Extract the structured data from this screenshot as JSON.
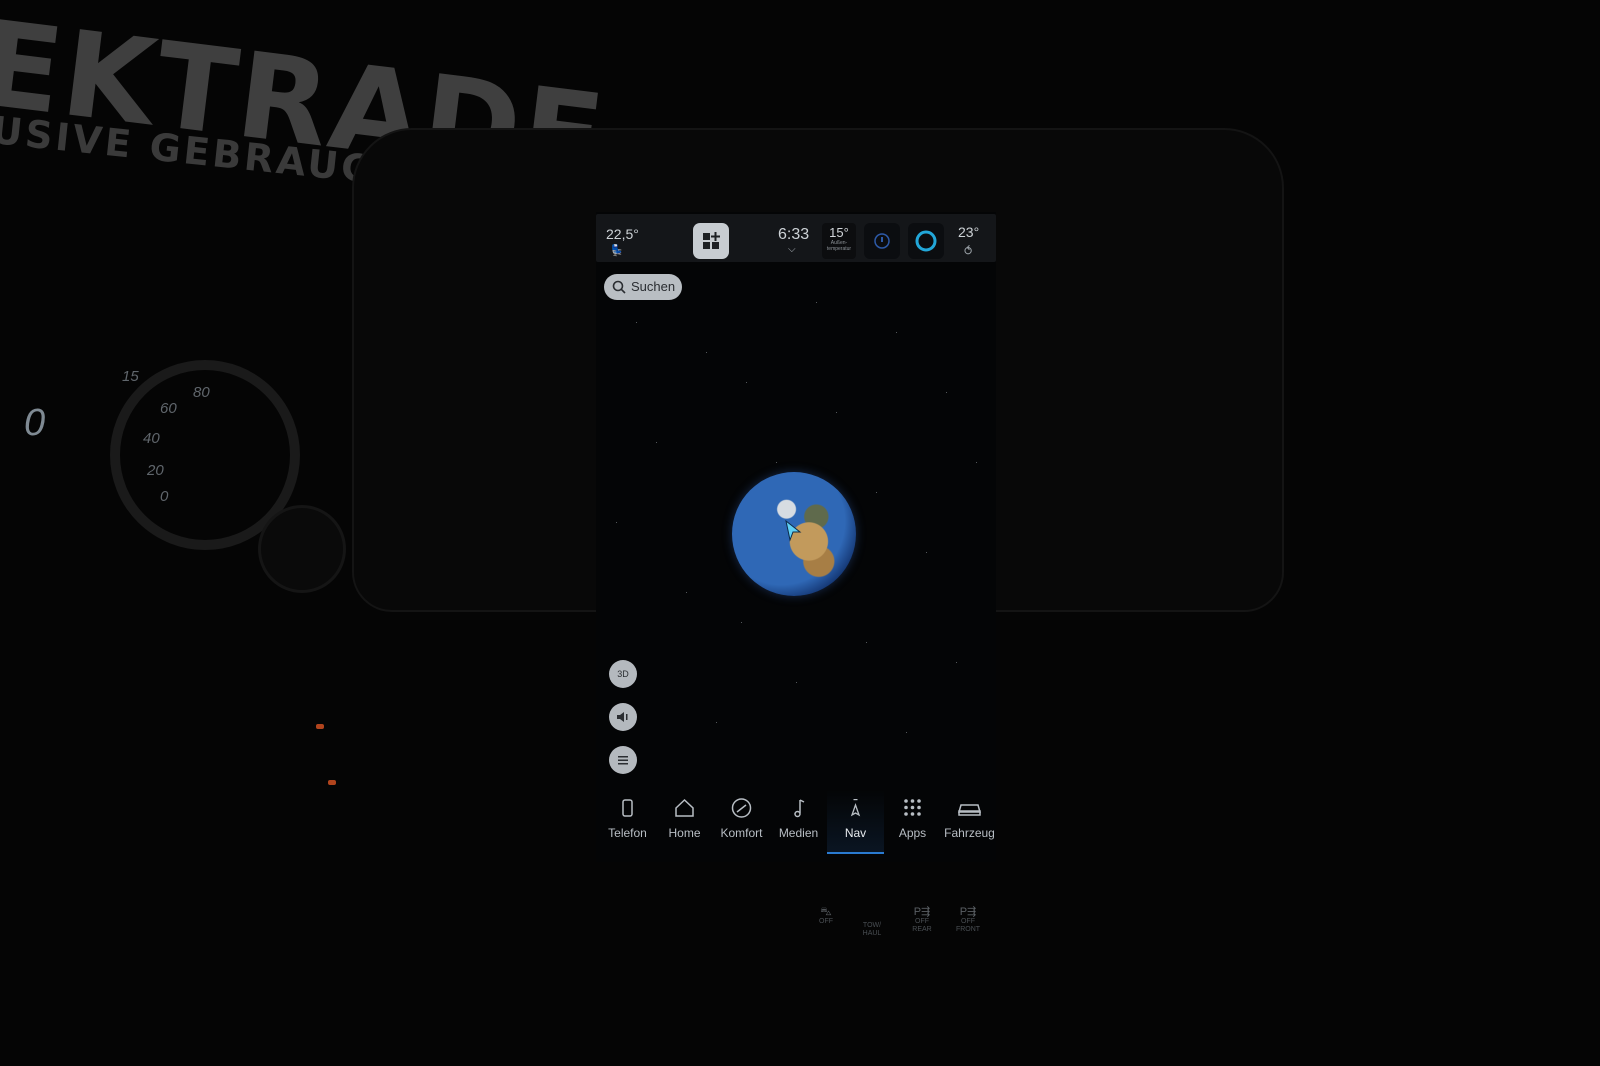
{
  "background": {
    "sign_main": "EKTRADE",
    "sign_sub": "USIVE GEBRAUCHTWAG",
    "cluster_speed": "0",
    "gauge_numbers": [
      "15",
      "80",
      "60",
      "40",
      "20",
      "0"
    ]
  },
  "status_bar": {
    "driver_temp": "22,5°",
    "clock": "6:33",
    "outside_temp": "15°",
    "outside_temp_label": "Außen-temperatur",
    "passenger_temp": "23°"
  },
  "search": {
    "label": "Suchen"
  },
  "map_controls": {
    "view_mode": "3D"
  },
  "nav": {
    "items": [
      {
        "label": "Telefon",
        "icon": "phone-icon"
      },
      {
        "label": "Home",
        "icon": "home-icon"
      },
      {
        "label": "Komfort",
        "icon": "comfort-icon"
      },
      {
        "label": "Medien",
        "icon": "music-note-icon"
      },
      {
        "label": "Nav",
        "icon": "nav-arrow-icon"
      },
      {
        "label": "Apps",
        "icon": "apps-grid-icon"
      },
      {
        "label": "Fahrzeug",
        "icon": "vehicle-icon"
      }
    ],
    "active": "Nav"
  },
  "physical_switches": [
    {
      "line1": "OFF",
      "line2": ""
    },
    {
      "line1": "TOW/",
      "line2": "HAUL"
    },
    {
      "line1": "OFF",
      "line2": "REAR"
    },
    {
      "line1": "OFF",
      "line2": "FRONT"
    }
  ],
  "colors": {
    "accent": "#2a7bd1",
    "alexa_ring": "#22a7d9",
    "screen_bg": "#040506"
  }
}
